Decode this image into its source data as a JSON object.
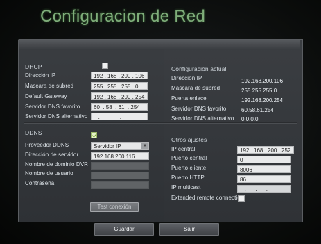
{
  "title": "Configuracion de Red",
  "dhcp": {
    "label": "DHCP",
    "checked": false
  },
  "left_fields": [
    {
      "label": "Dirección IP",
      "value": "192 . 168 . 200 . 106"
    },
    {
      "label": "Mascara de subred",
      "value": "255 . 255 . 255 . 0"
    },
    {
      "label": "Default Gateway",
      "value": "192 . 168 . 200 . 254"
    },
    {
      "label": "Servidor DNS favorito",
      "value": "60  . 58  . 61  . 254"
    },
    {
      "label": "Servidor DNS alternativo",
      "value": "   .      .      ."
    }
  ],
  "current": {
    "heading": "Configuración actual",
    "rows": [
      {
        "label": "Direccion IP",
        "value": "192.168.200.106"
      },
      {
        "label": "Mascara de subred",
        "value": "255.255.255.0"
      },
      {
        "label": "Puerta enlace",
        "value": "192.168.200.254"
      },
      {
        "label": "Servidor DNS favorito",
        "value": "60.58.61.254"
      },
      {
        "label": "Servidor DNS alternativo",
        "value": "0.0.0.0"
      }
    ]
  },
  "ddns": {
    "label": "DDNS",
    "checked": true,
    "provider_label": "Proveedor DDNS",
    "provider_value": "Servidor IP",
    "server_label": "Dirección de servidor",
    "server_value": "192.168.200.116",
    "domain_label": "Nombre de dominio DVR",
    "user_label": "Nombre de usuario",
    "password_label": "Contraseña",
    "test_button": "Test conexión"
  },
  "other": {
    "heading": "Otros ajustes",
    "rows": [
      {
        "label": "IP central",
        "value": "192 . 168 . 200 . 252"
      },
      {
        "label": "Puerto central",
        "value": "0"
      },
      {
        "label": "Puerto cliente",
        "value": "8006"
      },
      {
        "label": "Puerto HTTP",
        "value": "86"
      },
      {
        "label": "IP multicast",
        "value": "   .      .      ."
      }
    ],
    "extended_label": "Extended remote connection",
    "extended_checked": false
  },
  "footer": {
    "save": "Guardar",
    "exit": "Salir"
  },
  "colors": {
    "title": "#7fae7a",
    "panel": "#34373b",
    "field": "#e9eaeb"
  }
}
